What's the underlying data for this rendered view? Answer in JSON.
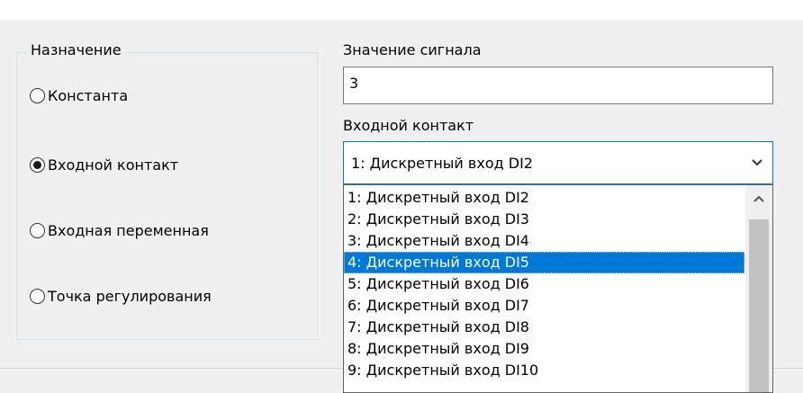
{
  "group": {
    "legend": "Назначение",
    "options": [
      {
        "label": "Константа",
        "checked": false
      },
      {
        "label": "Входной контакт",
        "checked": true
      },
      {
        "label": "Входная переменная",
        "checked": false
      },
      {
        "label": "Точка регулирования",
        "checked": false
      }
    ]
  },
  "signal": {
    "label": "Значение сигнала",
    "value": "3"
  },
  "input_contact": {
    "label": "Входной контакт",
    "selected": "1: Дискретный вход DI2",
    "options": [
      "1: Дискретный вход DI2",
      "2: Дискретный вход DI3",
      "3: Дискретный вход DI4",
      "4: Дискретный вход DI5",
      "5: Дискретный вход DI6",
      "6: Дискретный вход DI7",
      "7: Дискретный вход DI8",
      "8: Дискретный вход DI9",
      "9: Дискретный вход DI10"
    ],
    "highlighted_index": 3
  },
  "icons": {
    "combo_arrow": "chevron-down-icon",
    "scroll_up": "chevron-up-icon"
  },
  "colors": {
    "accent": "#0078d7",
    "dialog_bg": "#f0f0f0"
  }
}
